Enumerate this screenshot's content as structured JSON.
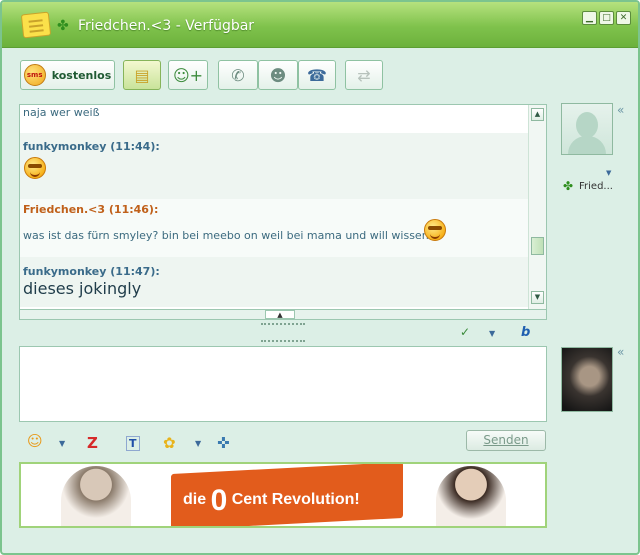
{
  "window": {
    "title": "Friedchen.<3 - Verfügbar",
    "accent": "#7fc24c"
  },
  "toolbar": {
    "sms_badge": "sms",
    "sms_label": "kostenlos"
  },
  "chat": {
    "messages": [
      {
        "author": "",
        "time": "",
        "text": "naja wer weiß",
        "emoticon": false
      },
      {
        "author": "funkymonkey",
        "time": "(11:44):",
        "text": "",
        "emoticon": true
      },
      {
        "author": "Friedchen.<3",
        "time": "(11:46):",
        "text": "was ist das fürn smyley? bin bei meebo on weil bei mama und will wissen",
        "emoticon": true
      },
      {
        "author": "funkymonkey",
        "time": "(11:47):",
        "text": "dieses jokingly",
        "emoticon": false
      }
    ],
    "colors": {
      "me": "#3a6b8a",
      "them": "#c0601a"
    }
  },
  "compose": {
    "send_label": "Senden"
  },
  "contacts": {
    "name": "Fried..."
  },
  "banner": {
    "text_pre": "die",
    "text_zero": "0",
    "text_post": "Cent Revolution!"
  },
  "icons": [
    "sms-icon",
    "notes-icon",
    "add-contact-icon",
    "phone-icon",
    "webcam-icon",
    "fax-icon",
    "transfer-icon",
    "spellcheck-icon",
    "bing-icon",
    "emoticon-icon",
    "buzz-icon",
    "font-icon",
    "wink-icon",
    "game-icon"
  ]
}
